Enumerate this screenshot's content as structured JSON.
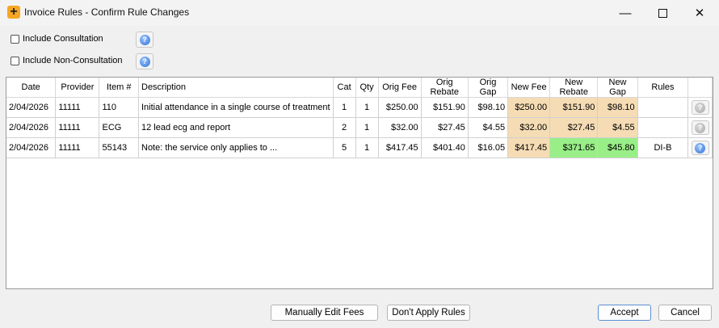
{
  "window": {
    "title": "Invoice Rules - Confirm Rule Changes",
    "app_icon_glyph": "+",
    "min_glyph": "—",
    "close_glyph": "✕"
  },
  "options": [
    {
      "label": "Include Consultation",
      "checked": false
    },
    {
      "label": "Include Non-Consultation",
      "checked": false
    }
  ],
  "help_glyph": "?",
  "table": {
    "columns": [
      "Date",
      "Provider",
      "Item #",
      "Description",
      "Cat",
      "Qty",
      "Orig Fee",
      "Orig Rebate",
      "Orig Gap",
      "New Fee",
      "New Rebate",
      "New Gap",
      "Rules"
    ],
    "rows": [
      {
        "date": "2/04/2026",
        "provider": "11111",
        "item": "110",
        "description": "Initial attendance in a single course of treatment",
        "cat": "1",
        "qty": "1",
        "orig_fee": "$250.00",
        "orig_rebate": "$151.90",
        "orig_gap": "$98.10",
        "new_fee": "$250.00",
        "new_rebate": "$151.90",
        "new_gap": "$98.10",
        "rules": ""
      },
      {
        "date": "2/04/2026",
        "provider": "11111",
        "item": "ECG",
        "description": "12 lead ecg and report",
        "cat": "2",
        "qty": "1",
        "orig_fee": "$32.00",
        "orig_rebate": "$27.45",
        "orig_gap": "$4.55",
        "new_fee": "$32.00",
        "new_rebate": "$27.45",
        "new_gap": "$4.55",
        "rules": ""
      },
      {
        "date": "2/04/2026",
        "provider": "11111",
        "item": "55143",
        "description": "Note: the service only applies to ...",
        "cat": "5",
        "qty": "1",
        "orig_fee": "$417.45",
        "orig_rebate": "$401.40",
        "orig_gap": "$16.05",
        "new_fee": "$417.45",
        "new_rebate": "$371.65",
        "new_gap": "$45.80",
        "rules": "DI-B"
      }
    ]
  },
  "buttons": {
    "manual": "Manually Edit Fees",
    "dont_apply": "Don't Apply Rules",
    "accept": "Accept",
    "cancel": "Cancel"
  },
  "colors": {
    "changed_fee": "#f5dcb4",
    "changed_rebate": "#99ee88"
  }
}
